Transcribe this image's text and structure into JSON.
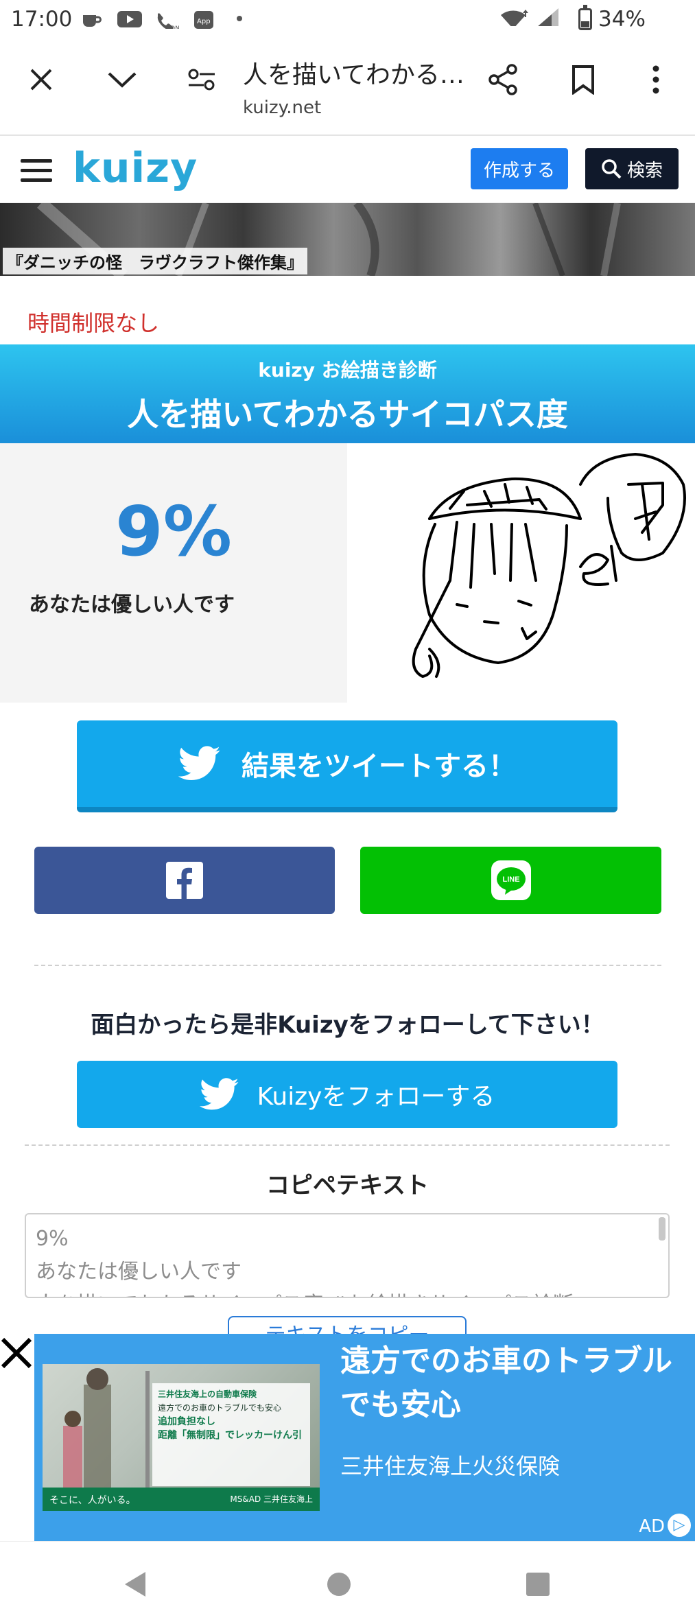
{
  "status_bar": {
    "time": "17:00",
    "battery": "34%",
    "icons": [
      "coffee-icon",
      "youtube-icon",
      "wifi-call-icon",
      "app-icon",
      "dot-icon",
      "wifi-icon",
      "signal-icon",
      "battery-icon"
    ]
  },
  "browser": {
    "page_title": "人を描いてわかる…",
    "url": "kuizy.net",
    "buttons": [
      "close-icon",
      "chevron-down-icon",
      "site-settings-icon",
      "share-icon",
      "bookmark-icon",
      "more-icon"
    ]
  },
  "site_header": {
    "logo": "kuizy",
    "create_label": "作成する",
    "search_label": "検索"
  },
  "banner": {
    "caption": "『ダニッチの怪　ラヴクラフト傑作集』"
  },
  "time_limit": "時間制限なし",
  "result_banner": {
    "subtitle": "kuizy お絵描き診断",
    "title": "人を描いてわかるサイコパス度"
  },
  "result": {
    "score": "9%",
    "text": "あなたは優しい人です"
  },
  "share": {
    "tweet_label": "結果をツイートする！",
    "facebook_icon": "facebook-icon",
    "line_icon_text": "LINE"
  },
  "follow": {
    "prompt": "面白かったら是非Kuizyをフォローして下さい！",
    "button_label": "Kuizyをフォローする"
  },
  "copipe": {
    "title": "コピペテキスト",
    "lines": [
      "9%",
      "あなたは優しい人です",
      "人を描いてわかるサイコパス度 #お絵描きサイコパス診断"
    ],
    "copy_button": "テキストをコピー"
  },
  "ad": {
    "headline": "遠方でのお車のトラブルでも安心",
    "advertiser": "三井住友海上火災保険",
    "label": "AD",
    "image_heading": "三井住友海上の自動車保険",
    "image_lines": [
      "遠方でのお車のトラブルでも安心",
      "追加負担なし",
      "距離「無制限」でレッカーけん引"
    ],
    "image_footer": "そこに、人がいる。",
    "image_brand": "MS&AD 三井住友海上"
  },
  "colors": {
    "brand": "#2aa7d8",
    "twitter": "#13a8ec",
    "facebook": "#3b5697",
    "line": "#03c004",
    "score": "#2a84d2",
    "time_limit": "#d0302c"
  }
}
